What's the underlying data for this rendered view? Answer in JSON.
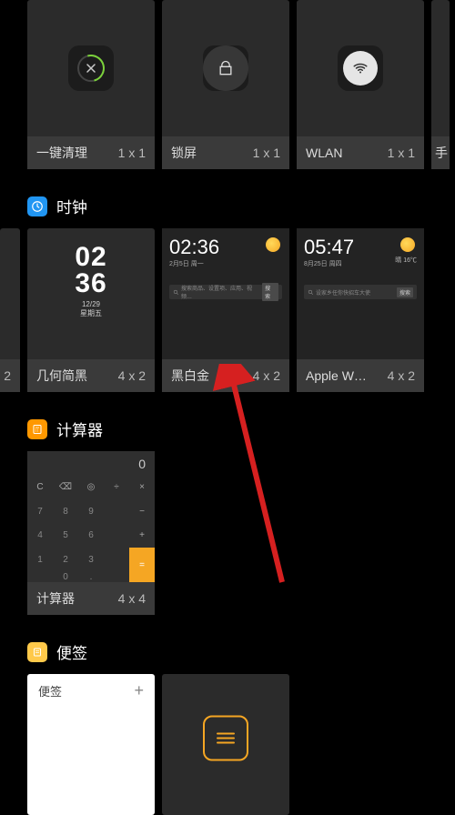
{
  "shortcuts": {
    "items": [
      {
        "label": "一键清理",
        "size": "1 x 1",
        "icon": "close-clean-icon"
      },
      {
        "label": "锁屏",
        "size": "1 x 1",
        "icon": "lock-icon"
      },
      {
        "label": "WLAN",
        "size": "1 x 1",
        "icon": "wifi-icon"
      },
      {
        "label": "手",
        "size": "",
        "icon": ""
      }
    ]
  },
  "sections": {
    "clock": {
      "title": "时钟"
    },
    "calc": {
      "title": "计算器"
    },
    "notes": {
      "title": "便签"
    }
  },
  "clock_widgets": {
    "partial_left_size": "2",
    "items": [
      {
        "label": "几何简黑",
        "size": "4 x 2",
        "time_top": "02",
        "time_bottom": "36",
        "date": "12/29",
        "weekday": "星期五"
      },
      {
        "label": "黑白金",
        "size": "4 x 2",
        "time": "02:36",
        "date": "2月5日 周一",
        "search_placeholder": "搜索商品、设置项、应用、视频…",
        "search_btn": "搜索"
      },
      {
        "label": "Apple W…",
        "size": "4 x 2",
        "time": "05:47",
        "date": "8月25日 周四",
        "temp": "晴 16℃",
        "search_placeholder": "设家乡任你快招车大使",
        "search_btn": "搜索"
      }
    ]
  },
  "calculator": {
    "label": "计算器",
    "size": "4 x 4",
    "display": "0",
    "keys": [
      [
        "C",
        "⌫",
        "⊘",
        "÷",
        "×"
      ],
      [
        "7",
        "8",
        "9",
        "",
        "-"
      ],
      [
        "4",
        "5",
        "6",
        "",
        "+"
      ],
      [
        "1",
        "2",
        "3",
        "",
        ""
      ],
      [
        "",
        "0",
        ".",
        "",
        "="
      ]
    ]
  },
  "notes_widgets": {
    "header": "便签",
    "plus": "+"
  }
}
